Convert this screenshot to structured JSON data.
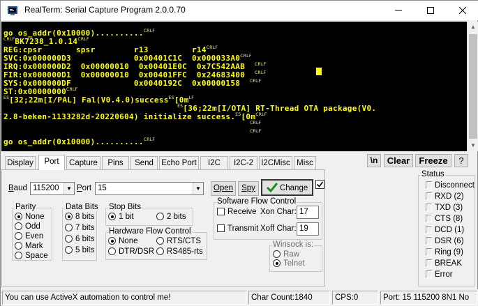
{
  "window": {
    "title": "RealTerm: Serial Capture Program 2.0.0.70"
  },
  "terminal": {
    "lines": [
      {
        "parts": [
          [
            "t",
            "go os_addr(0x10000).........."
          ],
          [
            "c",
            "CRLF"
          ]
        ]
      },
      {
        "parts": [
          [
            "c",
            "CRLF"
          ],
          [
            "t",
            "BK7238_1.0.14"
          ],
          [
            "c",
            "CRLF"
          ]
        ]
      },
      {
        "parts": [
          [
            "t",
            "REG:cpsr       spsr        r13         r14"
          ],
          [
            "c",
            "CRLF"
          ]
        ]
      },
      {
        "parts": [
          [
            "t",
            "SVC:0x000000D3             0x00401C1C  0x000033A0"
          ],
          [
            "c",
            "CRLF"
          ]
        ]
      },
      {
        "parts": [
          [
            "t",
            "IRQ:0x000000D2  0x00000010  0x00401E0C  0x7C542AAB  "
          ],
          [
            "c",
            "CRLF"
          ]
        ]
      },
      {
        "parts": [
          [
            "t",
            "FIR:0x000000D1  0x00000010  0x00401FFC  0x24683400  "
          ],
          [
            "c",
            "CRLF"
          ]
        ]
      },
      {
        "parts": [
          [
            "t",
            "SYS:0x000000DF             0x0040192C  0x00000158  "
          ],
          [
            "c",
            "CRLF"
          ]
        ]
      },
      {
        "parts": [
          [
            "t",
            "ST:0x00000000"
          ],
          [
            "c",
            "CRLF"
          ]
        ]
      },
      {
        "parts": [
          [
            "c",
            "ES"
          ],
          [
            "t",
            "[32;22m[I/PAL] Fal(V0.4.0)success"
          ],
          [
            "c",
            "ES"
          ],
          [
            "t",
            "[0m"
          ],
          [
            "c",
            "LF"
          ]
        ]
      },
      {
        "parts": [
          [
            "t",
            "                                    "
          ],
          [
            "c",
            "ES"
          ],
          [
            "t",
            "[36;22m[I/OTA] RT-Thread OTA package(V0."
          ]
        ]
      },
      {
        "parts": [
          [
            "t",
            "2.8-beken-1133282d-20220604) initialize success."
          ],
          [
            "c",
            "ES"
          ],
          [
            "t",
            "[0m"
          ],
          [
            "c",
            "CRLF"
          ]
        ]
      },
      {
        "parts": [
          [
            "t",
            "                                                   "
          ],
          [
            "c",
            "CRLF"
          ]
        ]
      },
      {
        "parts": [
          [
            "t",
            "                                                   "
          ],
          [
            "c",
            "CRLF"
          ]
        ]
      },
      {
        "parts": [
          [
            "t",
            "go os_addr(0x10000).........."
          ],
          [
            "c",
            "CRLF"
          ]
        ]
      }
    ]
  },
  "tabs": [
    "Display",
    "Port",
    "Capture",
    "Pins",
    "Send",
    "Echo Port",
    "I2C",
    "I2C-2",
    "I2CMisc",
    "Misc"
  ],
  "toolbar": {
    "newline": "\\n",
    "clear": "Clear",
    "freeze": "Freeze",
    "help": "?"
  },
  "port": {
    "baud_label": "Baud",
    "baud_value": "115200",
    "port_label": "Port",
    "port_value": "15",
    "open": "Open",
    "spy": "Spy",
    "change": "Change"
  },
  "parity": {
    "title": "Parity",
    "options": [
      "None",
      "Odd",
      "Even",
      "Mark",
      "Space"
    ],
    "selected": "None"
  },
  "databits": {
    "title": "Data Bits",
    "options": [
      "8 bits",
      "7 bits",
      "6 bits",
      "5 bits"
    ],
    "selected": "8 bits"
  },
  "stopbits": {
    "title": "Stop Bits",
    "options": [
      "1 bit",
      "2 bits"
    ],
    "selected": "1 bit"
  },
  "hwflow": {
    "title": "Hardware Flow Control",
    "options": [
      "None",
      "RTS/CTS",
      "DTR/DSR",
      "RS485-rts"
    ],
    "selected": "None"
  },
  "swflow": {
    "title": "Software Flow Control",
    "receive": "Receive",
    "xon_label": "Xon Char:",
    "xon_value": "17",
    "transmit": "Transmit",
    "xoff_label": "Xoff Char:",
    "xoff_value": "19"
  },
  "winsock": {
    "title": "Winsock is:",
    "options": [
      "Raw",
      "Telnet"
    ],
    "selected": "Telnet"
  },
  "status": {
    "title": "Status",
    "items": [
      "Disconnect",
      "RXD (2)",
      "TXD (3)",
      "CTS (8)",
      "DCD (1)",
      "DSR (6)",
      "Ring (9)",
      "BREAK",
      "Error"
    ]
  },
  "statusbar": {
    "message": "You can use ActiveX automation to control me!",
    "char_count": "Char Count:1840",
    "cps": "CPS:0",
    "port": "Port: 15 115200 8N1 No"
  },
  "colors": {
    "terminal_bg": "#000000",
    "terminal_fg": "#ffff00",
    "accent": "#1a7f1a"
  }
}
